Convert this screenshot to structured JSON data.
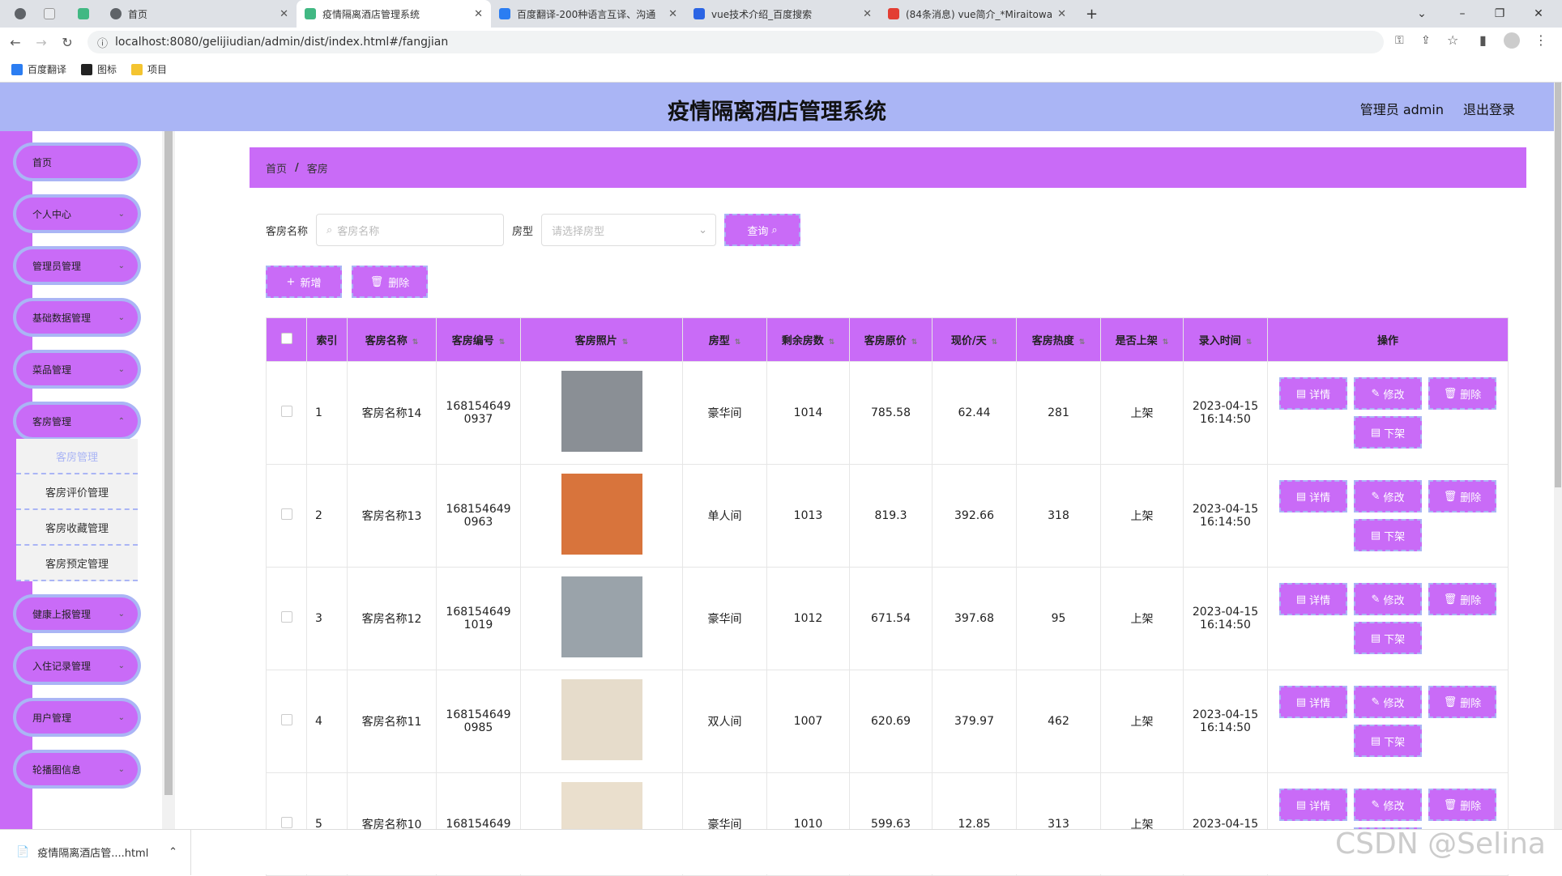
{
  "browser": {
    "tabs": [
      {
        "label": "首页",
        "color": "#5f6368"
      },
      {
        "label": "疫情隔离酒店管理系统",
        "color": "#41b883"
      },
      {
        "label": "百度翻译-200种语言互译、沟通",
        "color": "#2b7df2"
      },
      {
        "label": "vue技术介绍_百度搜索",
        "color": "#2b64e4"
      },
      {
        "label": "(84条消息) vue简介_*Miraitowa",
        "color": "#e33e33"
      }
    ],
    "url": "localhost:8080/gelijiudian/admin/dist/index.html#/fangjian",
    "bookmarks": [
      "百度翻译",
      "图标",
      "项目"
    ]
  },
  "header": {
    "title": "疫情隔离酒店管理系统",
    "user": "管理员 admin",
    "logout": "退出登录"
  },
  "sidebar": {
    "items": [
      "首页",
      "个人中心",
      "管理员管理",
      "基础数据管理",
      "菜品管理",
      "客房管理",
      "健康上报管理",
      "入住记录管理",
      "用户管理",
      "轮播图信息"
    ],
    "sub_items": [
      "客房管理",
      "客房评价管理",
      "客房收藏管理",
      "客房预定管理"
    ]
  },
  "breadcrumb": {
    "home": "首页",
    "sep": "/",
    "current": "客房"
  },
  "search": {
    "name_label": "客房名称",
    "name_placeholder": "客房名称",
    "type_label": "房型",
    "type_placeholder": "请选择房型",
    "query_btn": "查询",
    "add_btn": "新增",
    "delete_btn": "删除"
  },
  "table": {
    "headers": [
      "索引",
      "客房名称",
      "客房编号",
      "客房照片",
      "房型",
      "剩余房数",
      "客房原价",
      "现价/天",
      "客房热度",
      "是否上架",
      "录入时间",
      "操作"
    ],
    "ops": {
      "detail": "详情",
      "edit": "修改",
      "delete": "删除",
      "offline": "下架"
    },
    "rows": [
      {
        "idx": "1",
        "name": "客房名称14",
        "code1": "168154649",
        "code2": "0937",
        "type": "豪华间",
        "left": "1014",
        "orig": "785.58",
        "price": "62.44",
        "hot": "281",
        "status": "上架",
        "date": "2023-04-15",
        "time": "16:14:50",
        "photo": "#8a8f95"
      },
      {
        "idx": "2",
        "name": "客房名称13",
        "code1": "168154649",
        "code2": "0963",
        "type": "单人间",
        "left": "1013",
        "orig": "819.3",
        "price": "392.66",
        "hot": "318",
        "status": "上架",
        "date": "2023-04-15",
        "time": "16:14:50",
        "photo": "#d8743c"
      },
      {
        "idx": "3",
        "name": "客房名称12",
        "code1": "168154649",
        "code2": "1019",
        "type": "豪华间",
        "left": "1012",
        "orig": "671.54",
        "price": "397.68",
        "hot": "95",
        "status": "上架",
        "date": "2023-04-15",
        "time": "16:14:50",
        "photo": "#9aa3aa"
      },
      {
        "idx": "4",
        "name": "客房名称11",
        "code1": "168154649",
        "code2": "0985",
        "type": "双人间",
        "left": "1007",
        "orig": "620.69",
        "price": "379.97",
        "hot": "462",
        "status": "上架",
        "date": "2023-04-15",
        "time": "16:14:50",
        "photo": "#e6dccb"
      },
      {
        "idx": "5",
        "name": "客房名称10",
        "code1": "168154649",
        "code2": "",
        "type": "豪华间",
        "left": "1010",
        "orig": "599.63",
        "price": "12.85",
        "hot": "313",
        "status": "上架",
        "date": "2023-04-15",
        "time": "",
        "photo": "#eadfcd"
      }
    ]
  },
  "download": {
    "file": "疫情隔离酒店管....html"
  },
  "watermark": "CSDN @Selina"
}
